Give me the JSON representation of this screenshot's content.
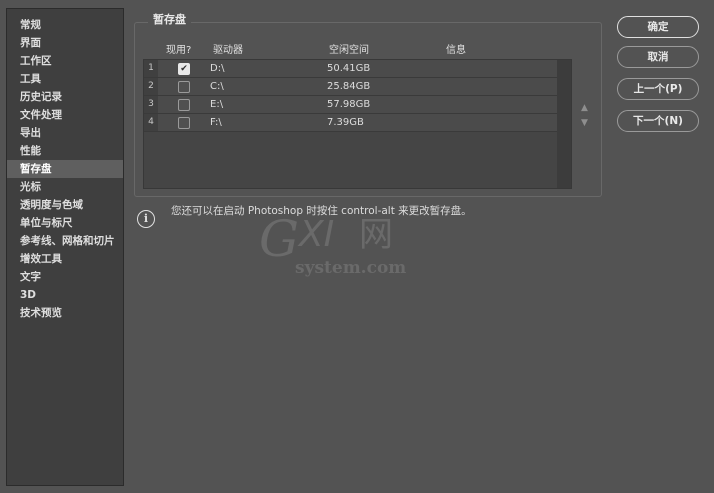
{
  "sidebar": {
    "items": [
      {
        "label": "常规"
      },
      {
        "label": "界面"
      },
      {
        "label": "工作区"
      },
      {
        "label": "工具"
      },
      {
        "label": "历史记录"
      },
      {
        "label": "文件处理"
      },
      {
        "label": "导出"
      },
      {
        "label": "性能"
      },
      {
        "label": "暂存盘",
        "selected": true
      },
      {
        "label": "光标"
      },
      {
        "label": "透明度与色域"
      },
      {
        "label": "单位与标尺"
      },
      {
        "label": "参考线、网格和切片"
      },
      {
        "label": "增效工具"
      },
      {
        "label": "文字"
      },
      {
        "label": "3D"
      },
      {
        "label": "技术预览"
      }
    ]
  },
  "scratch": {
    "title": "暂存盘",
    "columns": {
      "active": "现用?",
      "drive": "驱动器",
      "free": "空闲空间",
      "info": "信息"
    },
    "rows": [
      {
        "num": "1",
        "checked": true,
        "drive": "D:\\",
        "free": "50.41GB"
      },
      {
        "num": "2",
        "checked": false,
        "drive": "C:\\",
        "free": "25.84GB"
      },
      {
        "num": "3",
        "checked": false,
        "drive": "E:\\",
        "free": "57.98GB"
      },
      {
        "num": "4",
        "checked": false,
        "drive": "F:\\",
        "free": "7.39GB"
      }
    ],
    "move_up_icon": "triangle-up-icon",
    "move_down_icon": "triangle-down-icon",
    "note": "您还可以在启动 Photoshop 时按住 control-alt 来更改暂存盘。"
  },
  "buttons": {
    "ok": "确定",
    "cancel": "取消",
    "prev": "上一个(P)",
    "next": "下一个(N)"
  },
  "watermark": {
    "text_main": "GXI网",
    "text_sub": "system.com"
  }
}
